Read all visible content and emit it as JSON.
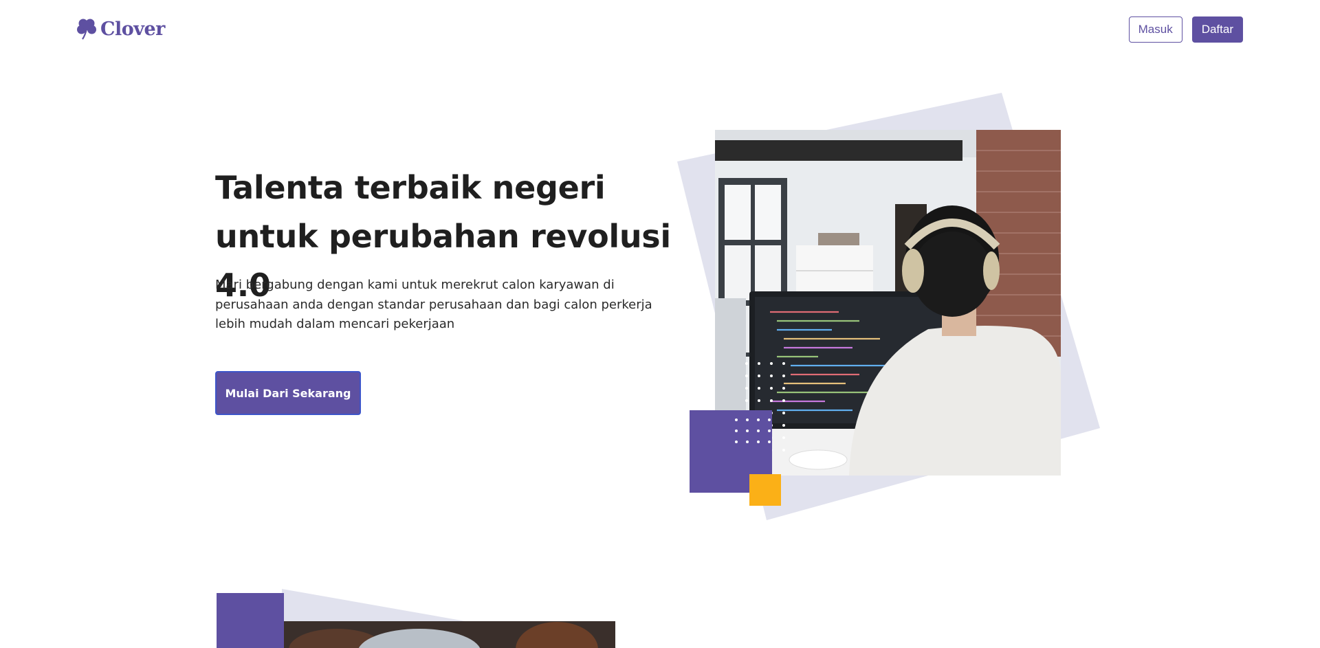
{
  "header": {
    "brand": "Clover",
    "login_label": "Masuk",
    "register_label": "Daftar"
  },
  "hero": {
    "title": "Talenta terbaik negeri untuk perubahan revolusi 4.0",
    "subtitle": "Mari bergabung dengan kami untuk merekrut calon karyawan di perusahaan anda dengan standar perusahaan dan bagi calon perkerja lebih mudah dalam mencari pekerjaan",
    "cta_label": "Mulai Dari Sekarang"
  },
  "colors": {
    "brand": "#5e50a1",
    "accent": "#fbb017",
    "shape_bg": "#e1e2ee"
  },
  "icons": {
    "logo": "clover-leaf-icon"
  }
}
